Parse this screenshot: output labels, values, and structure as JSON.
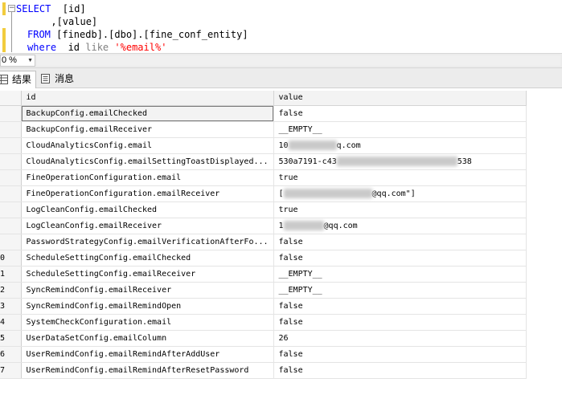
{
  "editor": {
    "lines": [
      {
        "kw": "SELECT",
        "rest": "  [id]"
      },
      {
        "plain": "      ,[value]"
      },
      {
        "kw": "FROM",
        "rest": " [finedb].[dbo].[fine_conf_entity]"
      },
      {
        "kw": "where",
        "mid": "  id ",
        "op": "like",
        "sp": " ",
        "str": "'%email%'"
      }
    ]
  },
  "zoom": {
    "value": "0 %"
  },
  "tabs": [
    {
      "label": "结果",
      "icon": "grid-icon"
    },
    {
      "label": "消息",
      "icon": "message-icon"
    }
  ],
  "grid": {
    "columns": [
      "id",
      "value"
    ],
    "rows": [
      {
        "n": "",
        "id": "BackupConfig.emailChecked",
        "value": "false"
      },
      {
        "n": "",
        "id": "BackupConfig.emailReceiver",
        "value": "__EMPTY__"
      },
      {
        "n": "",
        "id": "CloudAnalyticsConfig.email",
        "value": "10",
        "tail": "q.com"
      },
      {
        "n": "",
        "id": "CloudAnalyticsConfig.emailSettingToastDisplayed...",
        "value": "530a7191-c43",
        "tail": "538"
      },
      {
        "n": "",
        "id": "FineOperationConfiguration.email",
        "value": "true"
      },
      {
        "n": "",
        "id": "FineOperationConfiguration.emailReceiver",
        "value": "[",
        "tail": "@qq.com\"]"
      },
      {
        "n": "",
        "id": "LogCleanConfig.emailChecked",
        "value": "true"
      },
      {
        "n": "",
        "id": "LogCleanConfig.emailReceiver",
        "value": "1",
        "tail": "@qq.com"
      },
      {
        "n": "",
        "id": "PasswordStrategyConfig.emailVerificationAfterFo...",
        "value": "false"
      },
      {
        "n": "0",
        "id": "ScheduleSettingConfig.emailChecked",
        "value": "false"
      },
      {
        "n": "1",
        "id": "ScheduleSettingConfig.emailReceiver",
        "value": "__EMPTY__"
      },
      {
        "n": "2",
        "id": "SyncRemindConfig.emailReceiver",
        "value": "__EMPTY__"
      },
      {
        "n": "3",
        "id": "SyncRemindConfig.emailRemindOpen",
        "value": "false"
      },
      {
        "n": "4",
        "id": "SystemCheckConfiguration.email",
        "value": "false"
      },
      {
        "n": "5",
        "id": "UserDataSetConfig.emailColumn",
        "value": "26"
      },
      {
        "n": "6",
        "id": "UserRemindConfig.emailRemindAfterAddUser",
        "value": "false"
      },
      {
        "n": "7",
        "id": "UserRemindConfig.emailRemindAfterResetPassword",
        "value": "false"
      }
    ]
  },
  "colors": {
    "keyword": "#0000ff",
    "string": "#ff0000",
    "operator": "#808080",
    "change_marker": "#f2cc3d"
  }
}
